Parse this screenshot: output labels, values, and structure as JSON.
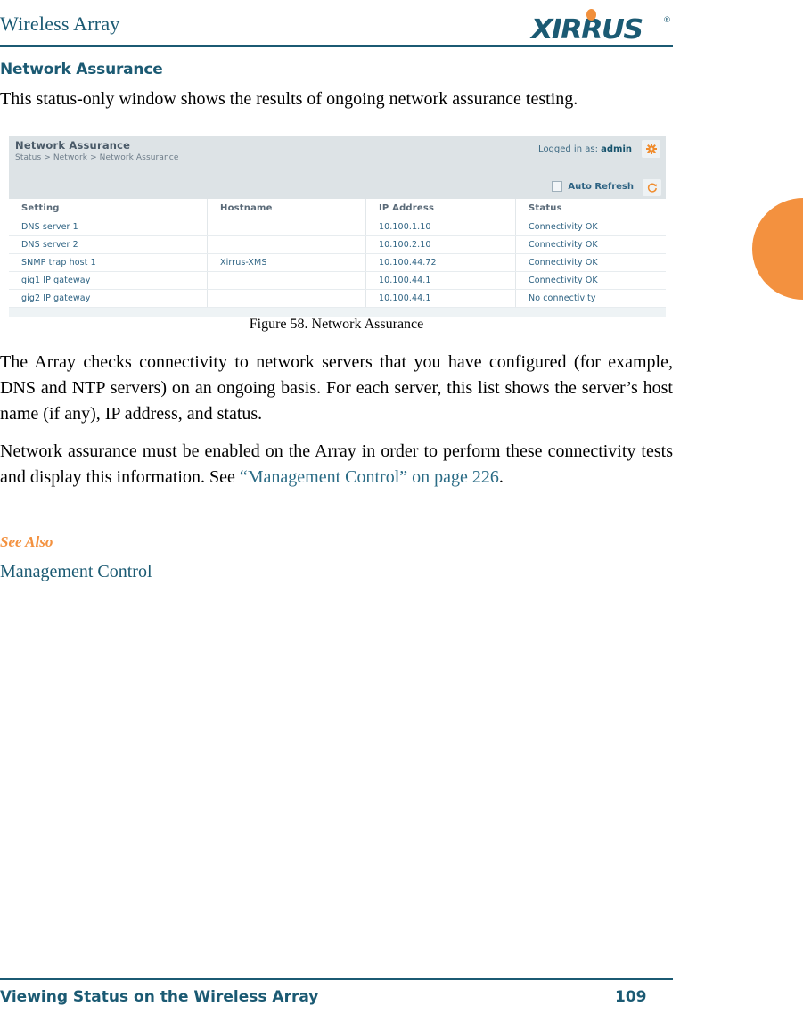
{
  "header": {
    "title": "Wireless Array",
    "logo_text": "XIRRUS",
    "logo_trademark": "®",
    "accent_color": "#1b5a73",
    "orange_color": "#f3913f"
  },
  "section": {
    "heading": "Network Assurance",
    "intro": "This status-only window shows the results of ongoing network assurance testing."
  },
  "app_window": {
    "title": "Network Assurance",
    "breadcrumb": "Status > Network > Network Assurance",
    "login_prefix": "Logged in as:",
    "login_user": "admin",
    "gear_icon": "gear-icon",
    "auto_refresh_label": "Auto Refresh",
    "auto_refresh_checked": false,
    "refresh_icon": "refresh-icon",
    "table": {
      "columns": [
        "Setting",
        "Hostname",
        "IP Address",
        "Status"
      ],
      "rows": [
        [
          "DNS server 1",
          "",
          "10.100.1.10",
          "Connectivity OK"
        ],
        [
          "DNS server 2",
          "",
          "10.100.2.10",
          "Connectivity OK"
        ],
        [
          "SNMP trap host 1",
          "Xirrus-XMS",
          "10.100.44.72",
          "Connectivity OK"
        ],
        [
          "gig1 IP gateway",
          "",
          "10.100.44.1",
          "Connectivity OK"
        ],
        [
          "gig2 IP gateway",
          "",
          "10.100.44.1",
          "No connectivity"
        ]
      ]
    }
  },
  "figure": {
    "caption": "Figure 58. Network Assurance"
  },
  "body": {
    "paragraph_1": "The Array checks connectivity to network servers that you have configured (for example, DNS and NTP servers) on an ongoing basis. For each server, this list shows the server’s host name (if any), IP address, and status.",
    "paragraph_2_before": "Network assurance must be enabled on the Array in order to perform these connectivity tests and display this information. See ",
    "paragraph_2_link": "“Management Control” on page 226",
    "paragraph_2_after": ".",
    "see_also_heading": "See Also",
    "see_also_link": "Management Control"
  },
  "footer": {
    "text": "Viewing Status on the Wireless Array",
    "page_number": "109"
  }
}
